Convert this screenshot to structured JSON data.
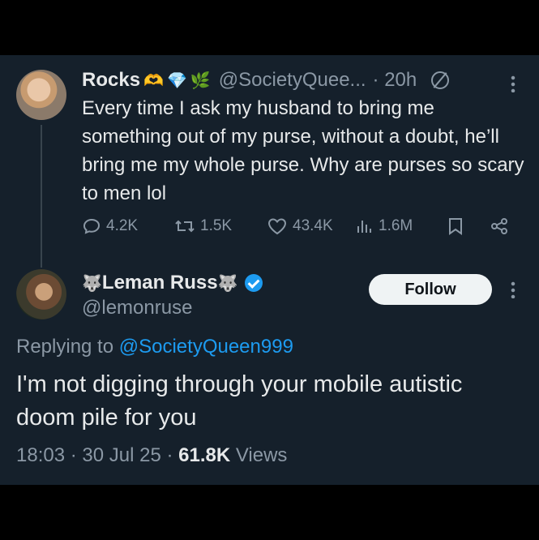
{
  "tweet1": {
    "name": "Rocks",
    "emojis": [
      "🫶",
      "💎",
      "🌿"
    ],
    "handle": "@SocietyQuee...",
    "time": "· 20h",
    "text": "Every time I ask my husband to bring me something out of my purse, without a doubt, he’ll bring me my whole purse. Why are purses so scary to men lol",
    "stats": {
      "replies": "4.2K",
      "retweets": "1.5K",
      "likes": "43.4K",
      "views": "1.6M"
    }
  },
  "tweet2": {
    "name": "Leman Russ",
    "name_emoji": "🐺",
    "handle": "@lemonruse",
    "follow_label": "Follow",
    "replying_prefix": "Replying to ",
    "replying_handle": "@SocietyQueen999",
    "text": "I'm not digging through your mobile autistic doom pile for you",
    "time": "18:03 · 30 Jul 25 · ",
    "views_count": "61.8K",
    "views_label": " Views"
  },
  "colors": {
    "background": "#15202b",
    "accent": "#1d9bf0",
    "muted": "#8b98a5",
    "text": "#e7e9ea"
  }
}
